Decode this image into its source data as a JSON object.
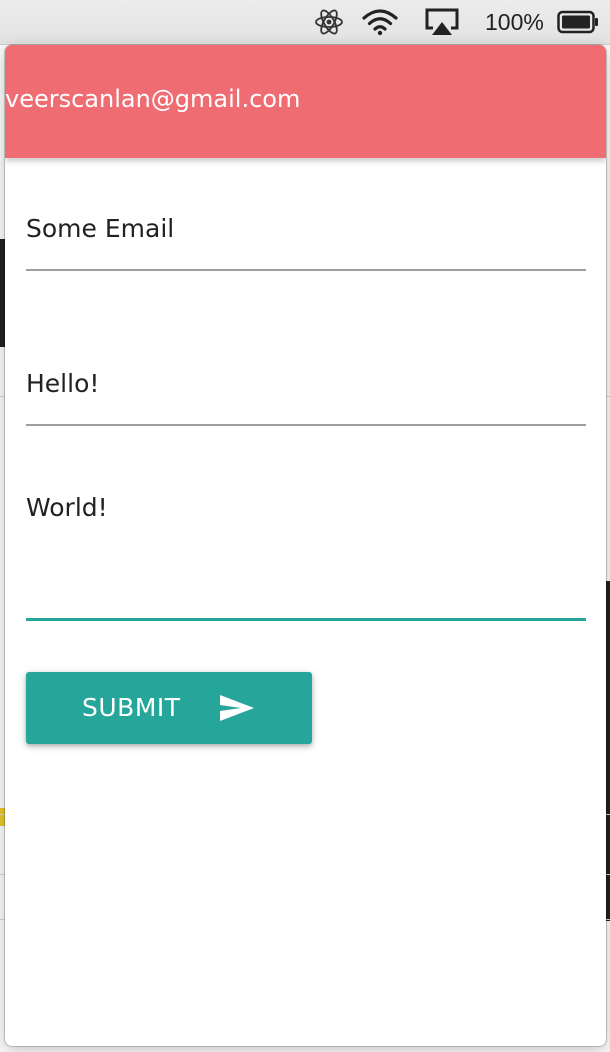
{
  "menubar": {
    "icons": [
      "atom-icon",
      "wifi-icon",
      "airplay-icon",
      "battery-icon"
    ],
    "battery_percent": "100%"
  },
  "popup": {
    "header": {
      "title": "veerscanlan@gmail.com",
      "color": "#ef6c73"
    },
    "form": {
      "email_field": {
        "value": "Some Email"
      },
      "subject_field": {
        "value": "Hello!"
      },
      "message_field": {
        "value": "World!"
      },
      "submit": {
        "label": "SUBMIT",
        "icon": "send-icon"
      }
    },
    "accent_color": "#26a69a"
  }
}
